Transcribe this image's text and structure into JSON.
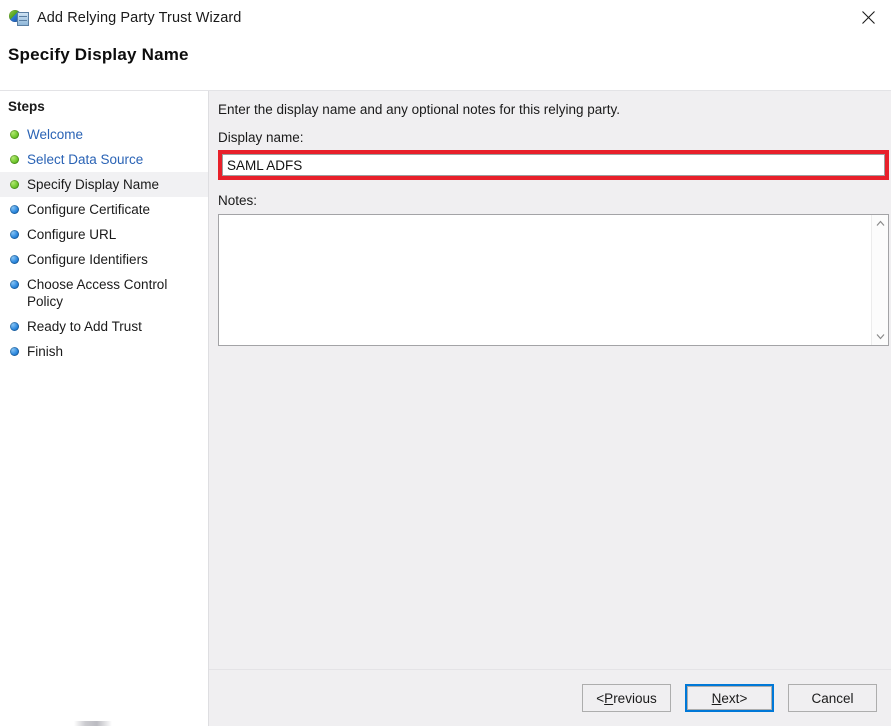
{
  "window": {
    "title": "Add Relying Party Trust Wizard",
    "icon": "relying-party-trust-icon",
    "close_label": "✕"
  },
  "page": {
    "heading": "Specify Display Name"
  },
  "sidebar": {
    "title": "Steps",
    "items": [
      {
        "label": "Welcome",
        "state": "completed",
        "bullet": "green",
        "link": true
      },
      {
        "label": "Select Data Source",
        "state": "completed",
        "bullet": "green",
        "link": true
      },
      {
        "label": "Specify Display Name",
        "state": "current",
        "bullet": "green",
        "link": false
      },
      {
        "label": "Configure Certificate",
        "state": "pending",
        "bullet": "blue",
        "link": false
      },
      {
        "label": "Configure URL",
        "state": "pending",
        "bullet": "blue",
        "link": false
      },
      {
        "label": "Configure Identifiers",
        "state": "pending",
        "bullet": "blue",
        "link": false
      },
      {
        "label": "Choose Access Control Policy",
        "state": "pending",
        "bullet": "blue",
        "link": false
      },
      {
        "label": "Ready to Add Trust",
        "state": "pending",
        "bullet": "blue",
        "link": false
      },
      {
        "label": "Finish",
        "state": "pending",
        "bullet": "blue",
        "link": false
      }
    ]
  },
  "main": {
    "intro": "Enter the display name and any optional notes for this relying party.",
    "display_name": {
      "label": "Display name:",
      "value": "SAML ADFS",
      "placeholder": "",
      "highlight_color": "#e8202a"
    },
    "notes": {
      "label": "Notes:",
      "value": "",
      "placeholder": "",
      "scrollbar": {
        "up_icon": "chevron-up-icon",
        "down_icon": "chevron-down-icon"
      }
    }
  },
  "footer": {
    "previous": {
      "prefix": "< ",
      "accel": "P",
      "rest": "revious"
    },
    "next": {
      "accel": "N",
      "rest": "ext",
      "suffix": " >",
      "focused": true
    },
    "cancel": {
      "label": "Cancel"
    }
  },
  "colors": {
    "content_bg": "#f0eff1",
    "sidebar_bg": "#ffffff",
    "link": "#2a63b5",
    "focus_ring": "#0078d7",
    "annotation": "#e8202a"
  }
}
